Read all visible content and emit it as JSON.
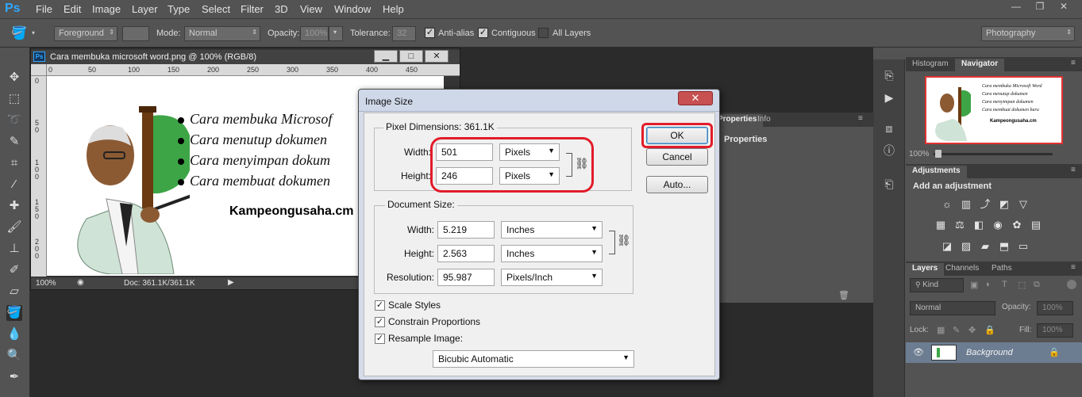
{
  "app": {
    "logo": "Ps",
    "menu": [
      "File",
      "Edit",
      "Image",
      "Layer",
      "Type",
      "Select",
      "Filter",
      "3D",
      "View",
      "Window",
      "Help"
    ],
    "window_buttons": [
      "—",
      "❐",
      "✕"
    ]
  },
  "options_bar": {
    "foreground_label": "Foreground",
    "mode_label": "Mode:",
    "mode_value": "Normal",
    "opacity_label": "Opacity:",
    "opacity_value": "100%",
    "tolerance_label": "Tolerance:",
    "tolerance_value": "32",
    "antialias_label": "Anti-alias",
    "antialias_checked": true,
    "contiguous_label": "Contiguous",
    "contiguous_checked": true,
    "all_layers_label": "All Layers",
    "all_layers_checked": false,
    "workspace": "Photography"
  },
  "document": {
    "title": "Cara membuka microsoft word.png @ 100% (RGB/8)",
    "ruler_h": [
      "0",
      "50",
      "100",
      "150",
      "200",
      "250",
      "300",
      "350",
      "400",
      "450"
    ],
    "ruler_v": [
      "0",
      "5 0",
      "1 0 0",
      "1 5 0",
      "2 0 0"
    ],
    "bullets": [
      "Cara membuka Microsof",
      "Cara menutup dokumen",
      "Cara menyimpan dokum",
      "Cara membuat dokumen"
    ],
    "watermark": "Kampeongusaha.cm",
    "zoom": "100%",
    "doc_size": "Doc: 361.1K/361.1K"
  },
  "dialog": {
    "title": "Image Size",
    "close_symbol": "✕",
    "pixel_dimensions_label": "Pixel Dimensions:",
    "pixel_dimensions_value": "361.1K",
    "width_label": "Width:",
    "width_value": "501",
    "width_unit": "Pixels",
    "height_label": "Height:",
    "height_value": "246",
    "height_unit": "Pixels",
    "document_size_label": "Document Size:",
    "doc_width_label": "Width:",
    "doc_width_value": "5.219",
    "doc_width_unit": "Inches",
    "doc_height_label": "Height:",
    "doc_height_value": "2.563",
    "doc_height_unit": "Inches",
    "resolution_label": "Resolution:",
    "resolution_value": "95.987",
    "resolution_unit": "Pixels/Inch",
    "scale_styles_label": "Scale Styles",
    "scale_styles_checked": true,
    "constrain_label": "Constrain Proportions",
    "constrain_checked": true,
    "resample_label": "Resample Image:",
    "resample_checked": true,
    "resample_method": "Bicubic Automatic",
    "ok_label": "OK",
    "cancel_label": "Cancel",
    "auto_label": "Auto...",
    "highlight_color": "#e21c2a"
  },
  "panels": {
    "top_tabs": [
      "Histogram",
      "Navigator"
    ],
    "nav_zoom": "100%",
    "nav_thumb_lines": [
      "Cara membuka Microsoft Word",
      "Cara menutup dokumen",
      "Cara menyimpan dokumen",
      "Cara membuat dokumen baru"
    ],
    "nav_thumb_watermark": "Kampeongusaha.cm",
    "properties_tabs": [
      "Properties",
      "Info"
    ],
    "properties_heading": "Properties",
    "adjustments_tab": "Adjustments",
    "adjustments_heading": "Add an adjustment",
    "layers_tabs": [
      "Layers",
      "Channels",
      "Paths"
    ],
    "kind_label": "Kind",
    "blend_mode": "Normal",
    "opacity_label": "Opacity:",
    "opacity_value": "100%",
    "lock_label": "Lock:",
    "fill_label": "Fill:",
    "fill_value": "100%",
    "layer_name": "Background"
  }
}
